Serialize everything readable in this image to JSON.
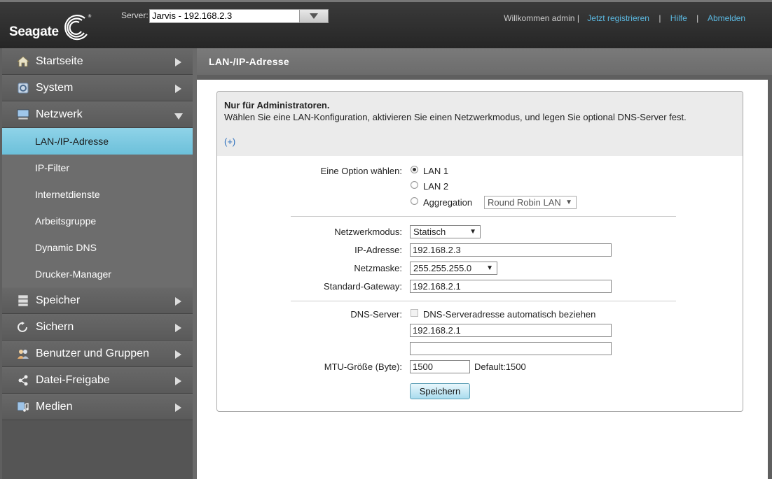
{
  "header": {
    "logo_text": "Seagate",
    "server_label": "Server:",
    "server_value": "Jarvis - 192.168.2.3",
    "welcome": "Willkommen admin |",
    "register": "Jetzt registrieren",
    "help": "Hilfe",
    "logout": "Abmelden"
  },
  "sidebar": {
    "items": [
      {
        "label": "Startseite",
        "icon": "home-icon"
      },
      {
        "label": "System",
        "icon": "gear-icon"
      },
      {
        "label": "Netzwerk",
        "icon": "network-icon"
      },
      {
        "label": "Speicher",
        "icon": "storage-icon"
      },
      {
        "label": "Sichern",
        "icon": "backup-icon"
      },
      {
        "label": "Benutzer und Gruppen",
        "icon": "users-icon"
      },
      {
        "label": "Datei-Freigabe",
        "icon": "share-icon"
      },
      {
        "label": "Medien",
        "icon": "media-icon"
      }
    ],
    "sub_items": [
      "LAN-/IP-Adresse",
      "IP-Filter",
      "Internetdienste",
      "Arbeitsgruppe",
      "Dynamic DNS",
      "Drucker-Manager"
    ]
  },
  "main": {
    "title": "LAN-/IP-Adresse",
    "admin_note": "Nur für Administratoren.",
    "description": "Wählen Sie eine LAN-Konfiguration, aktivieren Sie einen Netzwerkmodus, und legen Sie optional DNS-Server fest.",
    "expand": "(+)",
    "option_label": "Eine Option wählen:",
    "options": [
      "LAN 1",
      "LAN 2",
      "Aggregation"
    ],
    "aggregation_mode": "Round Robin LAN",
    "network_mode_label": "Netzwerkmodus:",
    "network_mode": "Statisch",
    "ip_label": "IP-Adresse:",
    "ip_value": "192.168.2.3",
    "netmask_label": "Netzmaske:",
    "netmask_value": "255.255.255.0",
    "gateway_label": "Standard-Gateway:",
    "gateway_value": "192.168.2.1",
    "dns_label": "DNS-Server:",
    "dns_auto": "DNS-Serveradresse automatisch beziehen",
    "dns1": "192.168.2.1",
    "dns2": "",
    "mtu_label": "MTU-Größe (Byte):",
    "mtu_value": "1500",
    "mtu_default": "Default:1500",
    "save": "Speichern"
  }
}
